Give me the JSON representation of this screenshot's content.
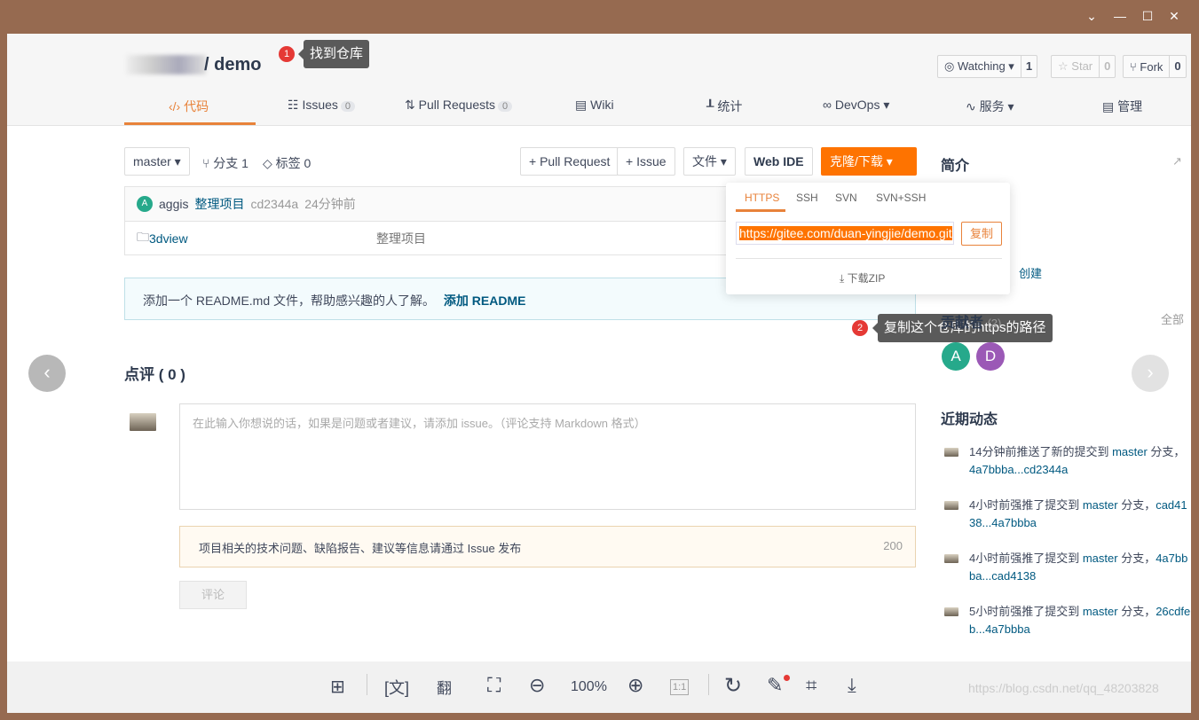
{
  "window": {
    "controls": [
      "⌄",
      "—",
      "☐",
      "✕"
    ]
  },
  "repo": {
    "name": "/ demo"
  },
  "annotations": [
    {
      "num": "1",
      "text": "找到仓库"
    },
    {
      "num": "2",
      "text": "复制这个仓库的https的路径"
    }
  ],
  "repo_actions": {
    "watch": "Watching",
    "watch_count": "1",
    "star": "Star",
    "star_count": "0",
    "fork": "Fork",
    "fork_count": "0"
  },
  "tabs": [
    {
      "label": "代码",
      "icon": "code-icon"
    },
    {
      "label": "Issues",
      "count": "0"
    },
    {
      "label": "Pull Requests",
      "count": "0"
    },
    {
      "label": "Wiki"
    },
    {
      "label": "统计"
    },
    {
      "label": "DevOps"
    },
    {
      "label": "服务"
    },
    {
      "label": "管理"
    }
  ],
  "toolbar": {
    "branch": "master",
    "branches": "分支 1",
    "tags": "标签 0",
    "new_pr": "+ Pull Request",
    "new_issue": "+ Issue",
    "file": "文件",
    "webide": "Web IDE",
    "clone": "克隆/下载"
  },
  "commit": {
    "avatar": "A",
    "author": "aggis",
    "message": "整理项目",
    "hash": "cd2344a",
    "time": "24分钟前"
  },
  "files": [
    {
      "name": "3dview",
      "message": "整理项目"
    }
  ],
  "readme_notice": {
    "text": "添加一个 README.md 文件，帮助感兴趣的人了解。",
    "link": "添加 README"
  },
  "clone_popup": {
    "tabs": [
      "HTTPS",
      "SSH",
      "SVN",
      "SVN+SSH"
    ],
    "active": "HTTPS",
    "url": "https://gitee.com/duan-yingjie/demo.git",
    "copy": "复制",
    "zip": "下载ZIP"
  },
  "comments": {
    "title": "点评 ( 0 )",
    "placeholder": "在此输入你想说的话，如果是问题或者建议，请添加 issue。（评论支持 Markdown 格式）",
    "notice": "项目相关的技术问题、缺陷报告、建议等信息请通过 Issue 发布",
    "remaining": "200",
    "submit": "评论"
  },
  "sidebar": {
    "intro": "简介",
    "created": "创建",
    "contributors": "贡献者",
    "contributors_count": "(2)",
    "all": "全部",
    "contributor_avatars": [
      {
        "letter": "A",
        "color": "#26a98b"
      },
      {
        "letter": "D",
        "color": "#9b59b6"
      }
    ],
    "activity_title": "近期动态",
    "activity": [
      {
        "text": "14分钟前推送了新的提交到 ",
        "branch": "master",
        "tail": " 分支，",
        "range": "4a7bbba...cd2344a"
      },
      {
        "text": "4小时前强推了提交到 ",
        "branch": "master",
        "tail": " 分支，",
        "range": "cad4138...4a7bbba"
      },
      {
        "text": "4小时前强推了提交到 ",
        "branch": "master",
        "tail": " 分支，",
        "range": "4a7bbba...cad4138"
      },
      {
        "text": "5小时前强推了提交到 ",
        "branch": "master",
        "tail": " 分支，",
        "range": "26cdfeb...4a7bbba"
      }
    ]
  },
  "viewer": {
    "zoom": "100%",
    "watermark": "https://blog.csdn.net/qq_48203828"
  },
  "colors": {
    "accent": "#fe7300",
    "link": "#005980",
    "frame": "#966a50"
  }
}
